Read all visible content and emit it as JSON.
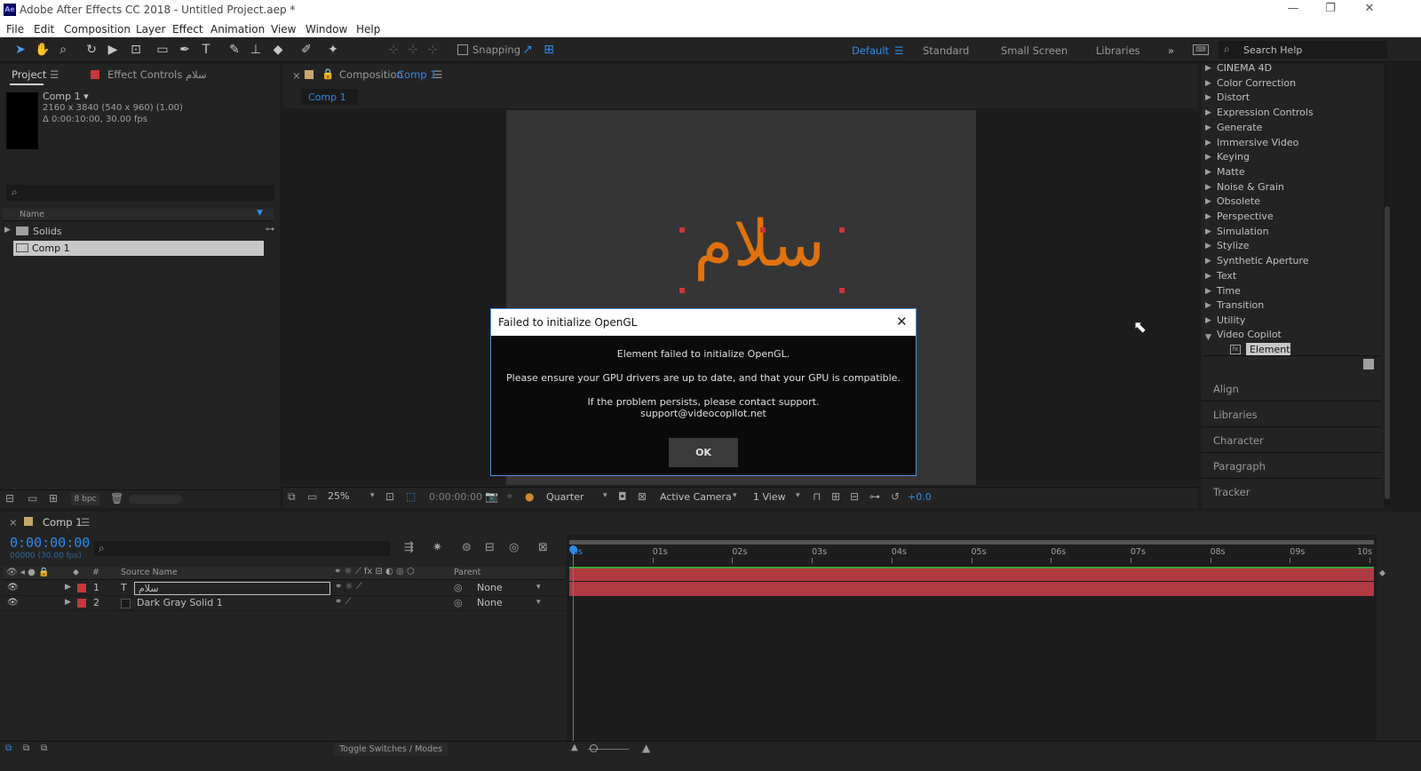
{
  "window": {
    "title": "Adobe After Effects CC 2018 - Untitled Project.aep *",
    "app_icon": "Ae"
  },
  "menu": [
    "File",
    "Edit",
    "Composition",
    "Layer",
    "Effect",
    "Animation",
    "View",
    "Window",
    "Help"
  ],
  "toolbar": {
    "snapping_label": "Snapping",
    "workspaces": [
      "Default",
      "Standard",
      "Small Screen",
      "Libraries"
    ],
    "search_placeholder": "Search Help"
  },
  "project_panel": {
    "tab_project": "Project",
    "tab_effect_controls": "Effect Controls سلام",
    "comp_name": "Comp 1 ▾",
    "comp_size": "2160 x 3840  (540 x 960) (1.00)",
    "comp_duration": "Δ 0:00:10:00, 30.00 fps",
    "column_name": "Name",
    "items": [
      {
        "label": "Solids",
        "type": "folder"
      },
      {
        "label": "Comp 1",
        "type": "comp"
      }
    ],
    "bpc": "8 bpc"
  },
  "composition_panel": {
    "header": "Composition",
    "comp_link": "Comp 1",
    "tab": "Comp 1",
    "text_layer_content": "سلام",
    "zoom": "25%",
    "timecode": "0:00:00:00",
    "resolution": "Quarter",
    "camera": "Active Camera",
    "views": "1 View",
    "exposure": "+0.0"
  },
  "dialog": {
    "title": "Failed to initialize OpenGL",
    "line1": "Element failed to initialize OpenGL.",
    "line2": "Please ensure your GPU drivers are up to date, and that your GPU is compatible.",
    "line3": "If the problem persists, please contact support.",
    "line4": "support@videocopilot.net",
    "ok_label": "OK"
  },
  "effects_panel": {
    "categories": [
      "CINEMA 4D",
      "Color Correction",
      "Distort",
      "Expression Controls",
      "Generate",
      "Immersive Video",
      "Keying",
      "Matte",
      "Noise & Grain",
      "Obsolete",
      "Perspective",
      "Simulation",
      "Stylize",
      "Synthetic Aperture",
      "Text",
      "Time",
      "Transition",
      "Utility"
    ],
    "expanded_category": "Video Copilot",
    "expanded_item": "Element",
    "side_panels": [
      "Align",
      "Libraries",
      "Character",
      "Paragraph",
      "Tracker"
    ]
  },
  "timeline": {
    "tab": "Comp 1",
    "timecode": "0:00:00:00",
    "fps_info": "00000 (30.00 fps)",
    "col_hash": "#",
    "col_source": "Source Name",
    "col_parent": "Parent",
    "ruler": [
      "0s",
      "01s",
      "02s",
      "03s",
      "04s",
      "05s",
      "06s",
      "07s",
      "08s",
      "09s",
      "10s"
    ],
    "layers": [
      {
        "index": "1",
        "type_icon": "T",
        "name": "سلام",
        "parent": "None"
      },
      {
        "index": "2",
        "type_icon": "",
        "name": "Dark Gray Solid 1",
        "parent": "None"
      }
    ],
    "toggle_label": "Toggle Switches / Modes"
  },
  "colors": {
    "accent_blue": "#2d8ceb",
    "layer_label_red": "#c8373b",
    "text_orange": "#e0720e",
    "bar_red": "#b03a41"
  }
}
